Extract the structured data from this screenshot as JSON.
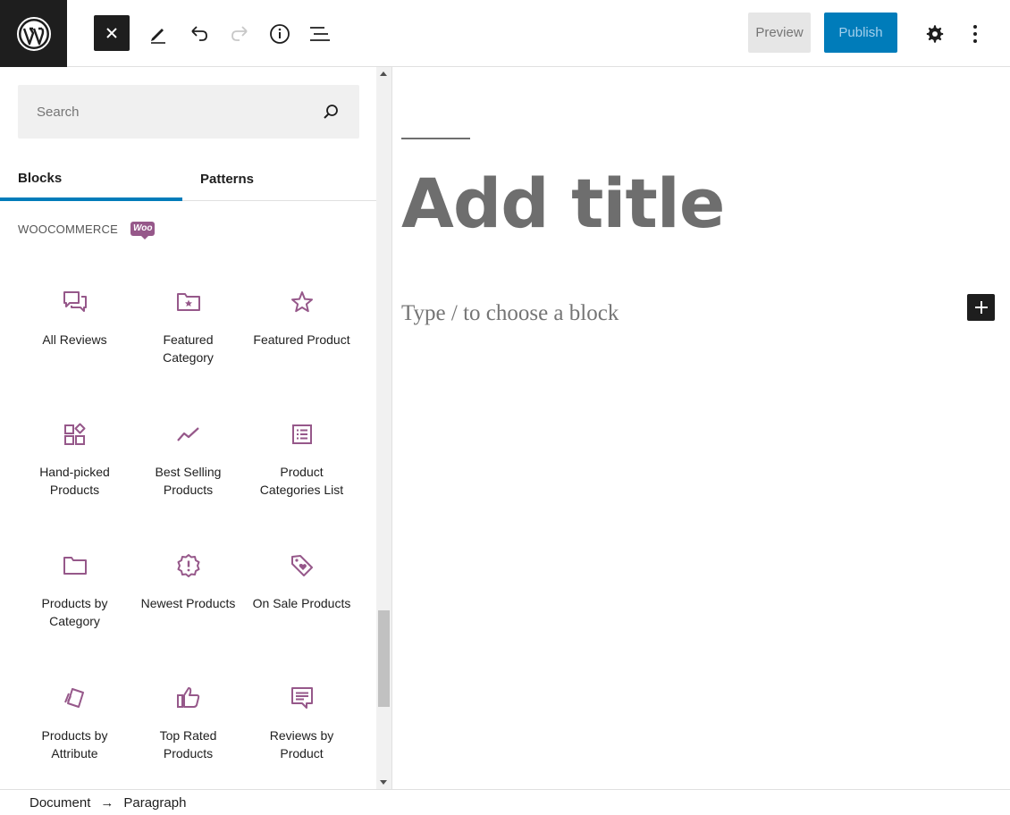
{
  "header": {
    "logo_icon": "wordpress-logo-icon",
    "tools": [
      {
        "name": "close-inserter-icon"
      },
      {
        "name": "pencil-tools-icon"
      },
      {
        "name": "undo-icon"
      },
      {
        "name": "redo-icon"
      },
      {
        "name": "info-icon"
      },
      {
        "name": "list-view-icon"
      }
    ],
    "preview_label": "Preview",
    "publish_label": "Publish",
    "settings_icon": "gear-icon",
    "options_icon": "more-vertical-icon"
  },
  "inserter": {
    "search": {
      "placeholder": "Search",
      "value": ""
    },
    "tabs": [
      {
        "label": "Blocks",
        "active": true
      },
      {
        "label": "Patterns",
        "active": false
      }
    ],
    "category": {
      "label": "WOOCOMMERCE",
      "badge": "Woo"
    },
    "blocks": [
      {
        "label": "All Reviews",
        "icon": "reviews-icon"
      },
      {
        "label": "Featured Category",
        "icon": "folder-star-icon"
      },
      {
        "label": "Featured Product",
        "icon": "star-icon"
      },
      {
        "label": "Hand-picked Products",
        "icon": "grid-pick-icon"
      },
      {
        "label": "Best Selling Products",
        "icon": "trend-line-icon"
      },
      {
        "label": "Product Categories List",
        "icon": "list-icon"
      },
      {
        "label": "Products by Category",
        "icon": "folder-icon"
      },
      {
        "label": "Newest Products",
        "icon": "new-badge-icon"
      },
      {
        "label": "On Sale Products",
        "icon": "tag-heart-icon"
      },
      {
        "label": "Products by Attribute",
        "icon": "cards-icon"
      },
      {
        "label": "Top Rated Products",
        "icon": "thumbs-up-icon"
      },
      {
        "label": "Reviews by Product",
        "icon": "comment-icon"
      }
    ]
  },
  "editor": {
    "title_placeholder": "Add title",
    "block_placeholder": "Type / to choose a block",
    "add_block_icon": "plus-icon"
  },
  "footer": {
    "breadcrumbs": [
      "Document",
      "Paragraph"
    ],
    "separator": "→"
  },
  "colors": {
    "accent": "#007cba",
    "woo_purple": "#96588a",
    "dark": "#1e1e1e"
  }
}
